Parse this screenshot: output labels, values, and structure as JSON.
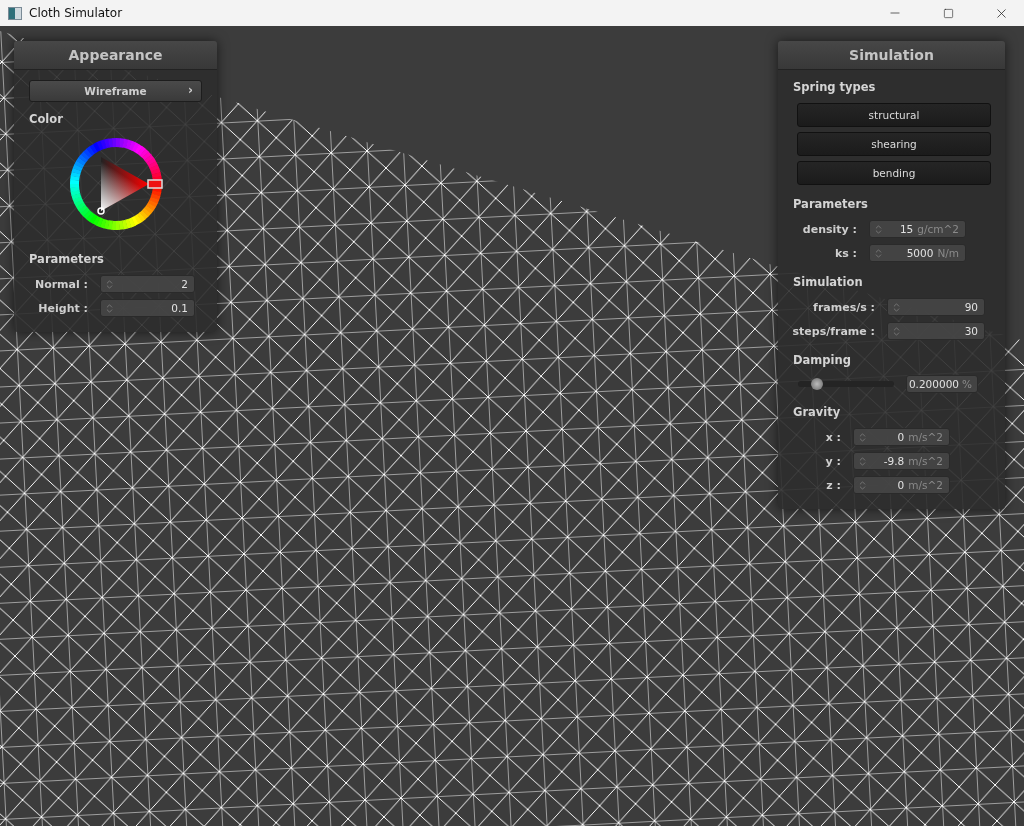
{
  "window": {
    "title": "Cloth Simulator"
  },
  "appearance": {
    "title": "Appearance",
    "mode_button": {
      "label": "Wireframe",
      "arrow": "›"
    },
    "color_label": "Color",
    "parameters_label": "Parameters",
    "fields": [
      {
        "label": "Normal :",
        "value": "2"
      },
      {
        "label": "Height :",
        "value": "0.1"
      }
    ]
  },
  "simulation": {
    "title": "Simulation",
    "spring_types": {
      "heading": "Spring types",
      "buttons": [
        "structural",
        "shearing",
        "bending"
      ]
    },
    "parameters": {
      "heading": "Parameters",
      "fields": [
        {
          "label": "density :",
          "value": "15",
          "unit": "g/cm^2"
        },
        {
          "label": "ks :",
          "value": "5000",
          "unit": "N/m"
        }
      ]
    },
    "simulation": {
      "heading": "Simulation",
      "fields": [
        {
          "label": "frames/s :",
          "value": "90"
        },
        {
          "label": "steps/frame :",
          "value": "30"
        }
      ]
    },
    "damping": {
      "heading": "Damping",
      "level": 0.2,
      "value": "0.200000",
      "unit": "%"
    },
    "gravity": {
      "heading": "Gravity",
      "fields": [
        {
          "label": "x :",
          "value": "0",
          "unit": "m/s^2"
        },
        {
          "label": "y :",
          "value": "-9.8",
          "unit": "m/s^2"
        },
        {
          "label": "z :",
          "value": "0",
          "unit": "m/s^2"
        }
      ]
    }
  }
}
